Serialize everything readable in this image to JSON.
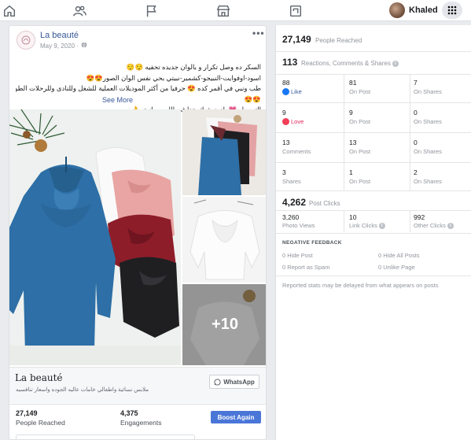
{
  "nav": {
    "icons": [
      "home-icon",
      "friends-icon",
      "flag-icon",
      "marketplace-icon",
      "pages-icon"
    ],
    "user_name": "Khaled"
  },
  "post": {
    "page_name": "La beauté",
    "date": "May 9, 2020 · ",
    "caption_lines": [
      "السكر ده وصل تكرار و بالوان جديده تحفيه 😌😌",
      "اسود-اوفوايت-النبيجو-كشمير-نبيتي بحي نفس الوان الصور😍😍",
      "طب ونبي في أقمر كده 😍 حرفيا من أكثر الموديلات العملية للشغل وللنادى وللرحلات الطويله كمان",
      "😍😍",
      "التوصيل 💗 يادوز شيك جدا في اللبس وانيق 👌 ..."
    ],
    "see_more": "See More",
    "photo_more": "+10",
    "brand_name": "La beauté",
    "brand_sub": "ملابس نسائية واطفالي خامات عاليه الجوده واسعار تنافسيه",
    "whatsapp_label": "WhatsApp",
    "people_reached_value": "27,149",
    "people_reached_label": "People Reached",
    "engagements_value": "4,375",
    "engagements_label": "Engagements",
    "boost_label": "Boost Again"
  },
  "insights": {
    "reached_value": "27,149",
    "reached_label": "People Reached",
    "reactions_value": "113",
    "reactions_label": "Reactions, Comments & Shares",
    "rows": [
      {
        "total": "88",
        "label": "Like",
        "on_post": "81",
        "on_post_label": "On Post",
        "on_shares": "7",
        "on_shares_label": "On Shares"
      },
      {
        "total": "9",
        "label": "Love",
        "on_post": "9",
        "on_post_label": "On Post",
        "on_shares": "0",
        "on_shares_label": "On Shares"
      },
      {
        "total": "13",
        "label": "Comments",
        "on_post": "13",
        "on_post_label": "On Post",
        "on_shares": "0",
        "on_shares_label": "On Shares"
      },
      {
        "total": "3",
        "label": "Shares",
        "on_post": "1",
        "on_post_label": "On Post",
        "on_shares": "2",
        "on_shares_label": "On Shares"
      }
    ],
    "clicks_value": "4,262",
    "clicks_label": "Post Clicks",
    "photo_views_value": "3,260",
    "photo_views_label": "Photo Views",
    "link_clicks_value": "10",
    "link_clicks_label": "Link Clicks",
    "other_clicks_value": "992",
    "other_clicks_label": "Other Clicks",
    "negative_title": "NEGATIVE FEEDBACK",
    "hide_post": "0 Hide Post",
    "hide_all": "0 Hide All Posts",
    "report_spam": "0 Report as Spam",
    "unlike_page": "0 Unlike Page",
    "note": "Reported stats may be delayed from what appears on posts"
  }
}
